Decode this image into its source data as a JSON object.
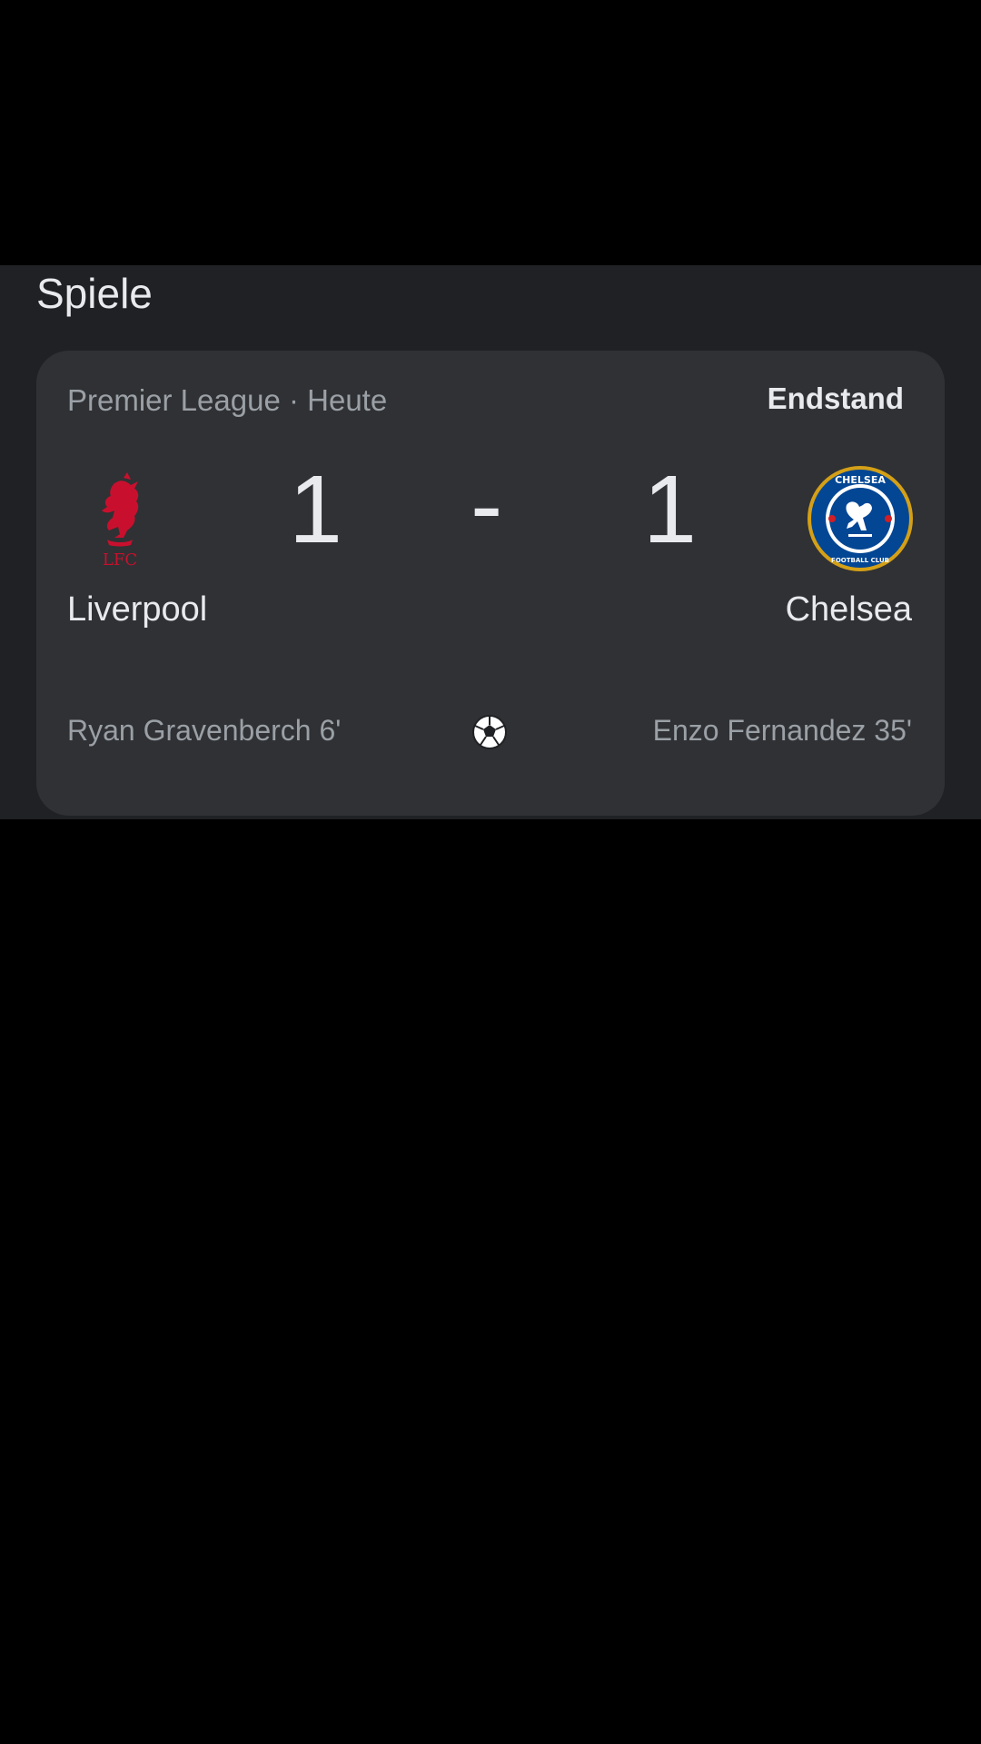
{
  "section": {
    "title": "Spiele"
  },
  "match": {
    "competition_line": "Premier League · Heute",
    "status": "Endstand",
    "home": {
      "name": "Liverpool",
      "score": "1",
      "crest_text": "LFC",
      "crest_color": "#c8102e"
    },
    "away": {
      "name": "Chelsea",
      "score": "1",
      "crest_top": "CHELSEA",
      "crest_bottom": "FOOTBALL CLUB",
      "crest_color": "#034694"
    },
    "separator": "-",
    "scorers": {
      "home": "Ryan Gravenberch 6'",
      "away": "Enzo Fernandez 35'"
    },
    "goal_icon": "soccer-ball-icon"
  },
  "colors": {
    "panel_bg": "#202124",
    "card_bg": "#303134",
    "text_primary": "#e8eaed",
    "text_secondary": "#9aa0a6"
  }
}
